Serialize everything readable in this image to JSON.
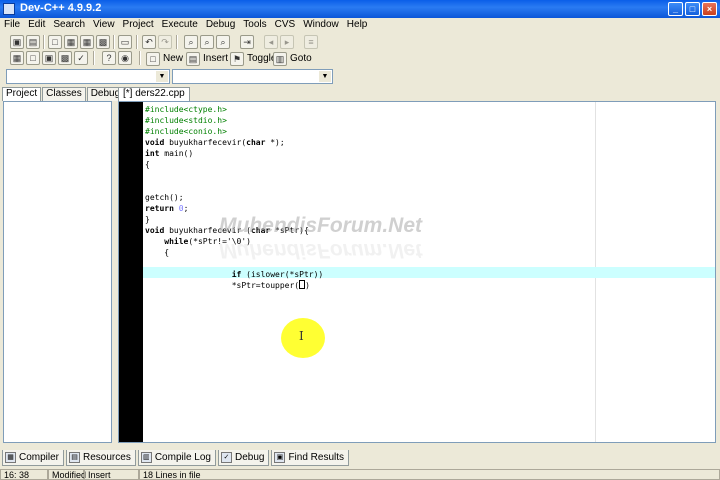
{
  "window": {
    "title": "Dev-C++ 4.9.9.2",
    "min": "_",
    "max": "□",
    "close": "×"
  },
  "menu": [
    "File",
    "Edit",
    "Search",
    "View",
    "Project",
    "Execute",
    "Debug",
    "Tools",
    "CVS",
    "Window",
    "Help"
  ],
  "toolbar2": {
    "new_label": "New",
    "insert_label": "Insert",
    "toggle_label": "Toggle",
    "goto_label": "Goto"
  },
  "left_tabs": [
    "Project",
    "Classes",
    "Debug"
  ],
  "editor": {
    "file_tab": "[*] ders22.cpp",
    "watermark": "MuhendisForum.Net",
    "cursor_glyph": "I"
  },
  "code_lines": [
    {
      "parts": [
        {
          "t": "#include<ctype.h>",
          "c": "pp"
        }
      ]
    },
    {
      "parts": [
        {
          "t": "#include<stdio.h>",
          "c": "pp"
        }
      ]
    },
    {
      "parts": [
        {
          "t": "#include<conio.h>",
          "c": "pp"
        }
      ]
    },
    {
      "parts": [
        {
          "t": "void",
          "c": "kw"
        },
        {
          "t": " buyukharfecevir(",
          "c": ""
        },
        {
          "t": "char",
          "c": "kw"
        },
        {
          "t": " *);",
          "c": ""
        }
      ]
    },
    {
      "parts": [
        {
          "t": "int",
          "c": "kw"
        },
        {
          "t": " main()",
          "c": ""
        }
      ]
    },
    {
      "parts": [
        {
          "t": "{",
          "c": ""
        }
      ]
    },
    {
      "parts": []
    },
    {
      "parts": []
    },
    {
      "parts": [
        {
          "t": "getch();",
          "c": ""
        }
      ]
    },
    {
      "parts": [
        {
          "t": "return",
          "c": "kw"
        },
        {
          "t": " ",
          "c": ""
        },
        {
          "t": "0",
          "c": "num"
        },
        {
          "t": ";",
          "c": ""
        }
      ]
    },
    {
      "parts": [
        {
          "t": "}",
          "c": ""
        }
      ]
    },
    {
      "parts": [
        {
          "t": "void",
          "c": "kw"
        },
        {
          "t": " buyukharfecevir (",
          "c": ""
        },
        {
          "t": "char",
          "c": "kw"
        },
        {
          "t": " *sPtr){",
          "c": ""
        }
      ]
    },
    {
      "parts": [
        {
          "t": "    ",
          "c": ""
        },
        {
          "t": "while",
          "c": "kw"
        },
        {
          "t": "(*sPtr!='\\0')",
          "c": ""
        }
      ]
    },
    {
      "parts": [
        {
          "t": "    {",
          "c": ""
        }
      ]
    },
    {
      "parts": []
    },
    {
      "parts": [
        {
          "t": "                  ",
          "c": ""
        },
        {
          "t": "if",
          "c": "kw"
        },
        {
          "t": " (islower(*sPtr))",
          "c": ""
        }
      ]
    },
    {
      "parts": [
        {
          "t": "                  *sPtr=toupper(",
          "c": ""
        },
        {
          "t": "",
          "c": "cursor"
        },
        {
          "t": ")",
          "c": ""
        }
      ]
    }
  ],
  "bottom_tabs": [
    {
      "label": "Compiler",
      "icon": "compiler-icon",
      "glyph": "▦"
    },
    {
      "label": "Resources",
      "icon": "resources-icon",
      "glyph": "▤"
    },
    {
      "label": "Compile Log",
      "icon": "compile-log-icon",
      "glyph": "▥"
    },
    {
      "label": "Debug",
      "icon": "debug-icon",
      "glyph": "✓"
    },
    {
      "label": "Find Results",
      "icon": "find-results-icon",
      "glyph": "▣"
    }
  ],
  "status": {
    "position": "16: 38",
    "modified": "Modified",
    "mode": "Insert",
    "lines": "18 Lines in file"
  }
}
